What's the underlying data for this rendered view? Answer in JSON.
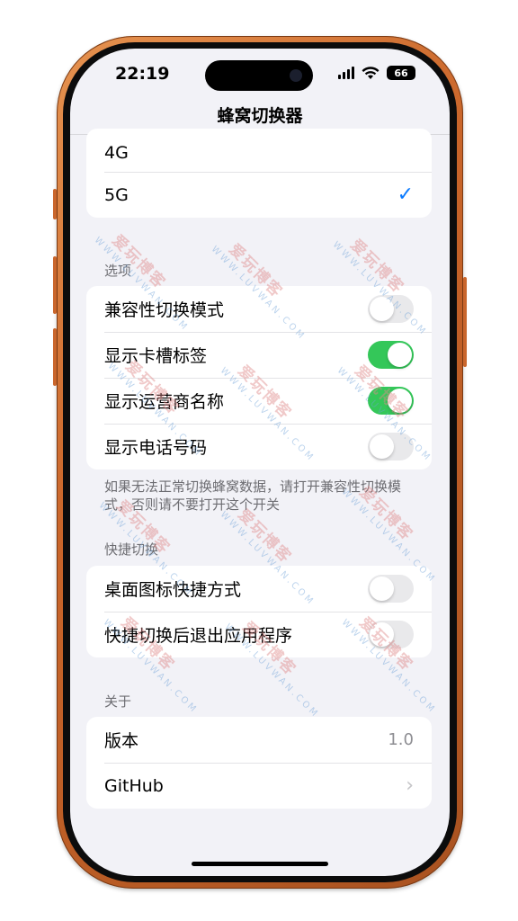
{
  "status_bar": {
    "time": "22:19",
    "battery": "66"
  },
  "nav": {
    "title": "蜂窝切换器"
  },
  "network_group": {
    "items": [
      {
        "label": "4G",
        "selected": false
      },
      {
        "label": "5G",
        "selected": true
      }
    ],
    "check_mark": "✓"
  },
  "options_section": {
    "header": "选项",
    "items": [
      {
        "label": "兼容性切换模式",
        "on": false
      },
      {
        "label": "显示卡槽标签",
        "on": true
      },
      {
        "label": "显示运营商名称",
        "on": true
      },
      {
        "label": "显示电话号码",
        "on": false
      }
    ],
    "footer": "如果无法正常切换蜂窝数据，请打开兼容性切换模式，否则请不要打开这个开关"
  },
  "shortcut_section": {
    "header": "快捷切换",
    "items": [
      {
        "label": "桌面图标快捷方式",
        "on": false
      },
      {
        "label": "快捷切换后退出应用程序",
        "on": false
      }
    ]
  },
  "about_section": {
    "header": "关于",
    "version_label": "版本",
    "version_value": "1.0",
    "github_label": "GitHub",
    "chevron": "›"
  },
  "watermark": {
    "cn": "爱玩博客",
    "en": "WWW.LUVWAN.COM"
  },
  "colors": {
    "toggle_on": "#34c759",
    "toggle_off": "#e9e9eb",
    "accent": "#0a7aff",
    "frame": "#c9652a"
  }
}
